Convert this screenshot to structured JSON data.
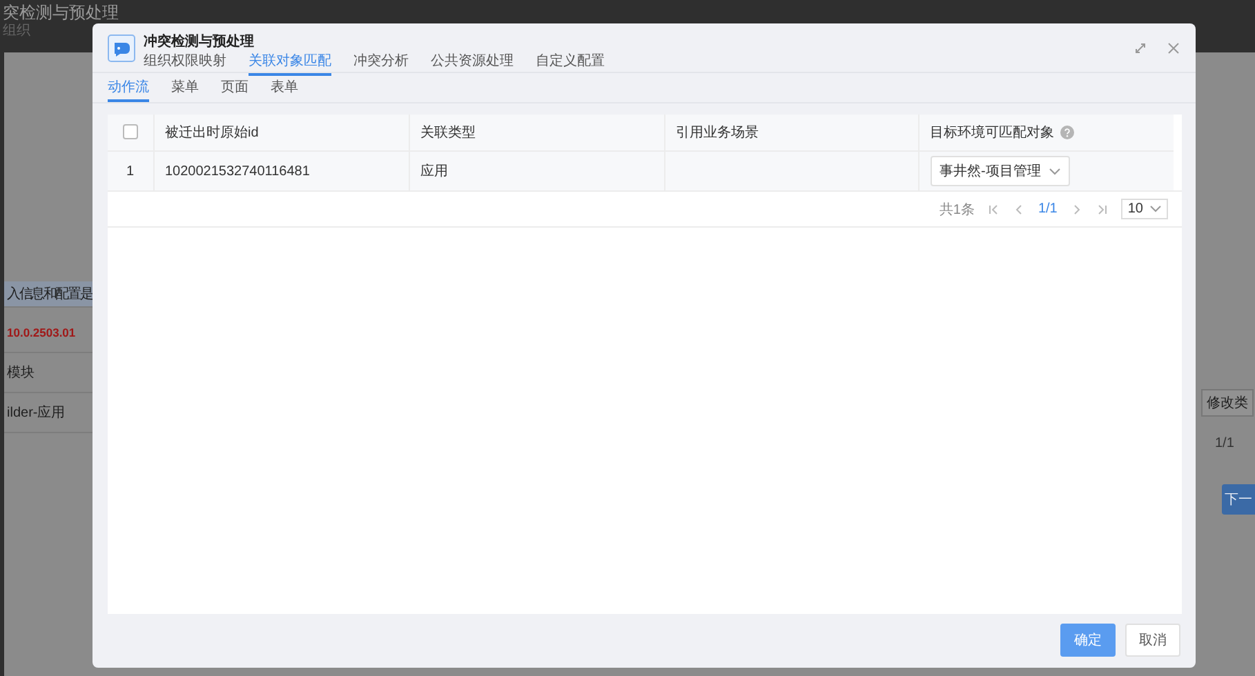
{
  "background_page": {
    "title": "突检测与预处理",
    "subtitle": "组织",
    "left_rows": [
      {
        "kind": "header",
        "text": "入信息和配置是"
      },
      {
        "kind": "version",
        "text": "10.0.2503.01"
      },
      {
        "kind": "text",
        "text": "模块"
      },
      {
        "kind": "text",
        "text": "ilder-应用"
      }
    ],
    "right_button": "修改类",
    "right_pager": "1/1",
    "next_button": "下一"
  },
  "dialog": {
    "title": "冲突检测与预处理",
    "tabs": [
      {
        "label": "组织权限映射",
        "selected": false
      },
      {
        "label": "关联对象匹配",
        "selected": true
      },
      {
        "label": "冲突分析",
        "selected": false
      },
      {
        "label": "公共资源处理",
        "selected": false
      },
      {
        "label": "自定义配置",
        "selected": false
      }
    ],
    "sub_tabs": [
      {
        "label": "动作流",
        "selected": true
      },
      {
        "label": "菜单",
        "selected": false
      },
      {
        "label": "页面",
        "selected": false
      },
      {
        "label": "表单",
        "selected": false
      }
    ],
    "table": {
      "select_all_checked": false,
      "columns": [
        {
          "label": "被迁出时原始id",
          "help": false
        },
        {
          "label": "关联类型",
          "help": false
        },
        {
          "label": "引用业务场景",
          "help": false
        },
        {
          "label": "目标环境可匹配对象",
          "help": true
        }
      ],
      "rows": [
        {
          "index": "1",
          "original_id": "1020021532740116481",
          "type": "应用",
          "scene": "",
          "target": "事井然-项目管理"
        }
      ]
    },
    "pagination": {
      "total": "共1条",
      "page": "1/1",
      "page_size": "10"
    },
    "buttons": [
      {
        "label": "确定",
        "kind": "primary"
      },
      {
        "label": "取消",
        "kind": "default"
      }
    ]
  }
}
